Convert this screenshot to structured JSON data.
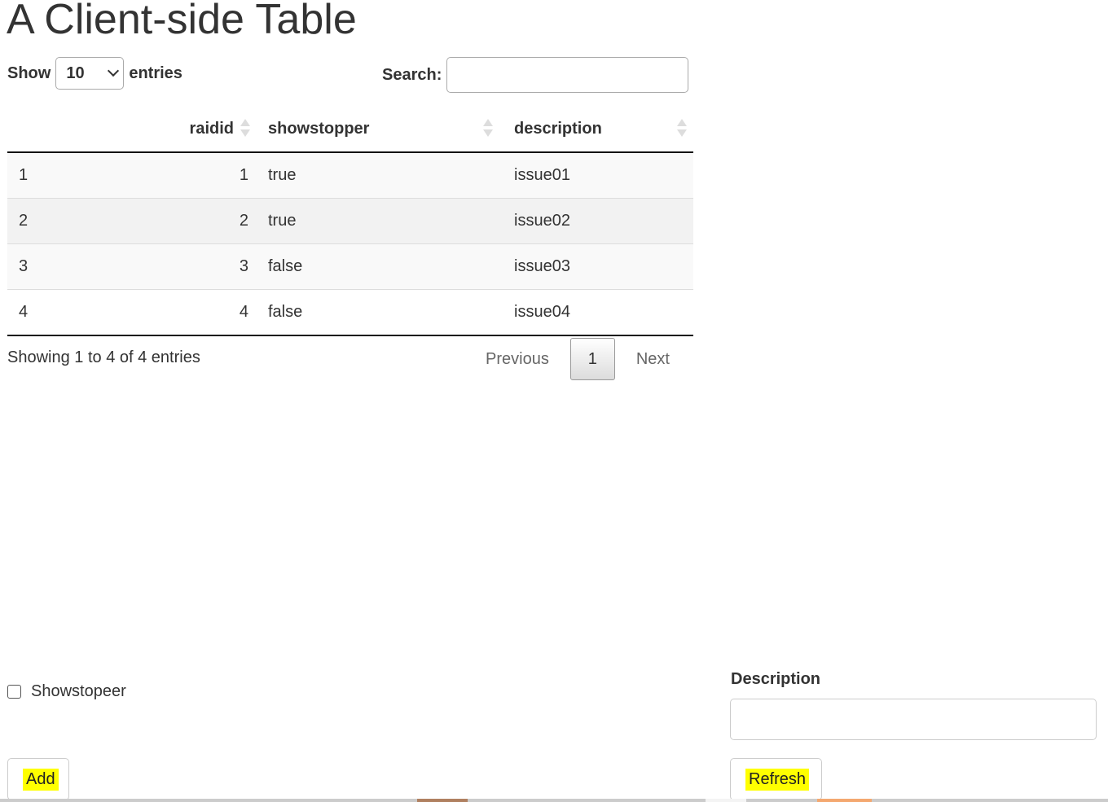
{
  "page": {
    "title": "A Client-side Table"
  },
  "table_controls": {
    "show_label": "Show",
    "page_length": "10",
    "entries_label": "entries",
    "search_label": "Search:",
    "search_value": ""
  },
  "table": {
    "columns": [
      "",
      "raidid",
      "showstopper",
      "description"
    ],
    "rows": [
      [
        "1",
        "1",
        "true",
        "issue01"
      ],
      [
        "2",
        "2",
        "true",
        "issue02"
      ],
      [
        "3",
        "3",
        "false",
        "issue03"
      ],
      [
        "4",
        "4",
        "false",
        "issue04"
      ]
    ]
  },
  "footer": {
    "info": "Showing 1 to 4 of 4 entries",
    "previous": "Previous",
    "current_page": "1",
    "next": "Next"
  },
  "form": {
    "checkbox_label": "Showstopeer",
    "checkbox_checked": false,
    "description_label": "Description",
    "description_value": "",
    "add_button": "Add",
    "refresh_button": "Refresh",
    "highlight_color": "#ffff00"
  }
}
